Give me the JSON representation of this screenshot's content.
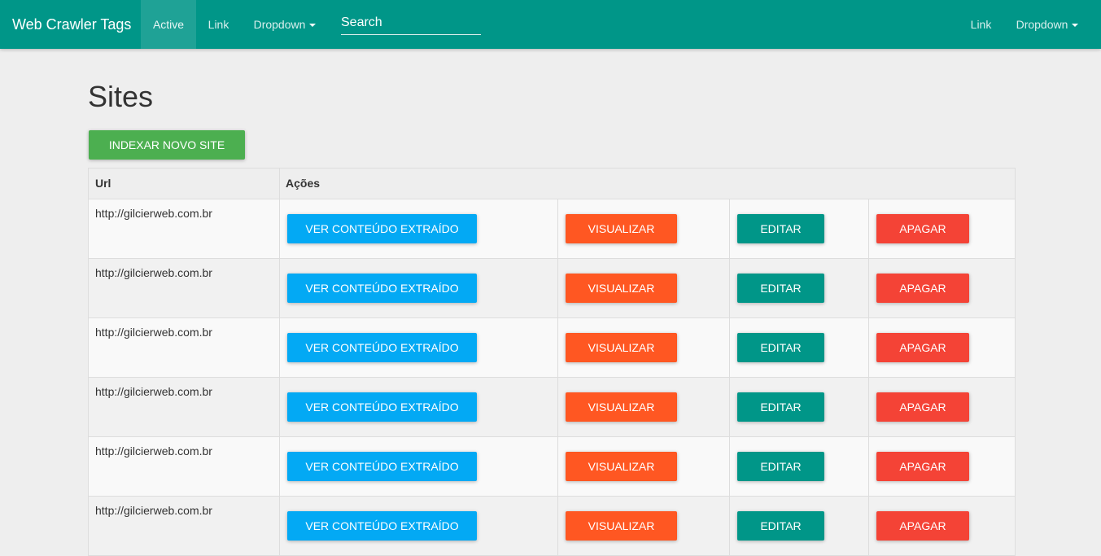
{
  "navbar": {
    "brand": "Web Crawler Tags",
    "left_items": [
      {
        "label": "Active",
        "active": true
      },
      {
        "label": "Link"
      },
      {
        "label": "Dropdown",
        "dropdown": true
      }
    ],
    "search_placeholder": "Search",
    "right_items": [
      {
        "label": "Link"
      },
      {
        "label": "Dropdown",
        "dropdown": true
      }
    ]
  },
  "page": {
    "title": "Sites",
    "add_button": "INDEXAR NOVO SITE"
  },
  "table": {
    "headers": [
      "Url",
      "Ações"
    ],
    "actions": {
      "view_content": "VER CONTEÚDO EXTRAÍDO",
      "visualize": "VISUALIZAR",
      "edit": "EDITAR",
      "delete": "APAGAR"
    },
    "rows": [
      {
        "url": "http://gilcierweb.com.br"
      },
      {
        "url": "http://gilcierweb.com.br"
      },
      {
        "url": "http://gilcierweb.com.br"
      },
      {
        "url": "http://gilcierweb.com.br"
      },
      {
        "url": "http://gilcierweb.com.br"
      },
      {
        "url": "http://gilcierweb.com.br"
      }
    ]
  },
  "colors": {
    "primary": "#009688",
    "success": "#4caf50",
    "info": "#03a9f4",
    "warning": "#ff5722",
    "danger": "#f44336"
  }
}
